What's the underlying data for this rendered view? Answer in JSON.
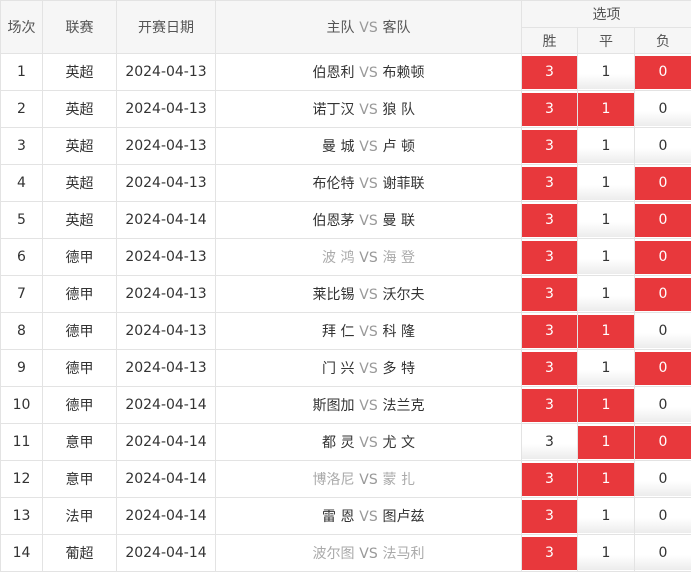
{
  "header": {
    "round": "场次",
    "league": "联赛",
    "date": "开赛日期",
    "match": "主队",
    "vs": "VS",
    "away": "客队",
    "options": "选项",
    "win": "胜",
    "draw": "平",
    "loss": "负"
  },
  "colors": {
    "selected": "#e8383c",
    "border": "#e3e3e3",
    "header_bg": "#f6f6f6"
  },
  "rows": [
    {
      "no": "1",
      "league": "英超",
      "date": "2024-04-13",
      "home": "伯恩利",
      "vs": "VS",
      "away": "布赖顿",
      "dim": false,
      "w": "3",
      "d": "1",
      "l": "0",
      "sel": [
        true,
        false,
        true
      ]
    },
    {
      "no": "2",
      "league": "英超",
      "date": "2024-04-13",
      "home": "诺丁汉",
      "vs": "VS",
      "away": "狼 队",
      "dim": false,
      "w": "3",
      "d": "1",
      "l": "0",
      "sel": [
        true,
        true,
        false
      ]
    },
    {
      "no": "3",
      "league": "英超",
      "date": "2024-04-13",
      "home": "曼 城",
      "vs": "VS",
      "away": "卢 顿",
      "dim": false,
      "w": "3",
      "d": "1",
      "l": "0",
      "sel": [
        true,
        false,
        false
      ]
    },
    {
      "no": "4",
      "league": "英超",
      "date": "2024-04-13",
      "home": "布伦特",
      "vs": "VS",
      "away": "谢菲联",
      "dim": false,
      "w": "3",
      "d": "1",
      "l": "0",
      "sel": [
        true,
        false,
        true
      ]
    },
    {
      "no": "5",
      "league": "英超",
      "date": "2024-04-14",
      "home": "伯恩茅",
      "vs": "VS",
      "away": "曼 联",
      "dim": false,
      "w": "3",
      "d": "1",
      "l": "0",
      "sel": [
        true,
        false,
        true
      ]
    },
    {
      "no": "6",
      "league": "德甲",
      "date": "2024-04-13",
      "home": "波 鸿",
      "vs": "VS",
      "away": "海 登",
      "dim": true,
      "w": "3",
      "d": "1",
      "l": "0",
      "sel": [
        true,
        false,
        true
      ]
    },
    {
      "no": "7",
      "league": "德甲",
      "date": "2024-04-13",
      "home": "莱比锡",
      "vs": "VS",
      "away": "沃尔夫",
      "dim": false,
      "w": "3",
      "d": "1",
      "l": "0",
      "sel": [
        true,
        false,
        true
      ]
    },
    {
      "no": "8",
      "league": "德甲",
      "date": "2024-04-13",
      "home": "拜 仁",
      "vs": "VS",
      "away": "科 隆",
      "dim": false,
      "w": "3",
      "d": "1",
      "l": "0",
      "sel": [
        true,
        true,
        false
      ]
    },
    {
      "no": "9",
      "league": "德甲",
      "date": "2024-04-13",
      "home": "门 兴",
      "vs": "VS",
      "away": "多 特",
      "dim": false,
      "w": "3",
      "d": "1",
      "l": "0",
      "sel": [
        true,
        false,
        true
      ]
    },
    {
      "no": "10",
      "league": "德甲",
      "date": "2024-04-14",
      "home": "斯图加",
      "vs": "VS",
      "away": "法兰克",
      "dim": false,
      "w": "3",
      "d": "1",
      "l": "0",
      "sel": [
        true,
        true,
        false
      ]
    },
    {
      "no": "11",
      "league": "意甲",
      "date": "2024-04-14",
      "home": "都 灵",
      "vs": "VS",
      "away": "尤 文",
      "dim": false,
      "w": "3",
      "d": "1",
      "l": "0",
      "sel": [
        false,
        true,
        true
      ]
    },
    {
      "no": "12",
      "league": "意甲",
      "date": "2024-04-14",
      "home": "博洛尼",
      "vs": "VS",
      "away": "蒙 扎",
      "dim": true,
      "w": "3",
      "d": "1",
      "l": "0",
      "sel": [
        true,
        true,
        false
      ]
    },
    {
      "no": "13",
      "league": "法甲",
      "date": "2024-04-14",
      "home": "雷 恩",
      "vs": "VS",
      "away": "图卢兹",
      "dim": false,
      "w": "3",
      "d": "1",
      "l": "0",
      "sel": [
        true,
        false,
        false
      ]
    },
    {
      "no": "14",
      "league": "葡超",
      "date": "2024-04-14",
      "home": "波尔图",
      "vs": "VS",
      "away": "法马利",
      "dim": true,
      "w": "3",
      "d": "1",
      "l": "0",
      "sel": [
        true,
        false,
        false
      ]
    }
  ]
}
